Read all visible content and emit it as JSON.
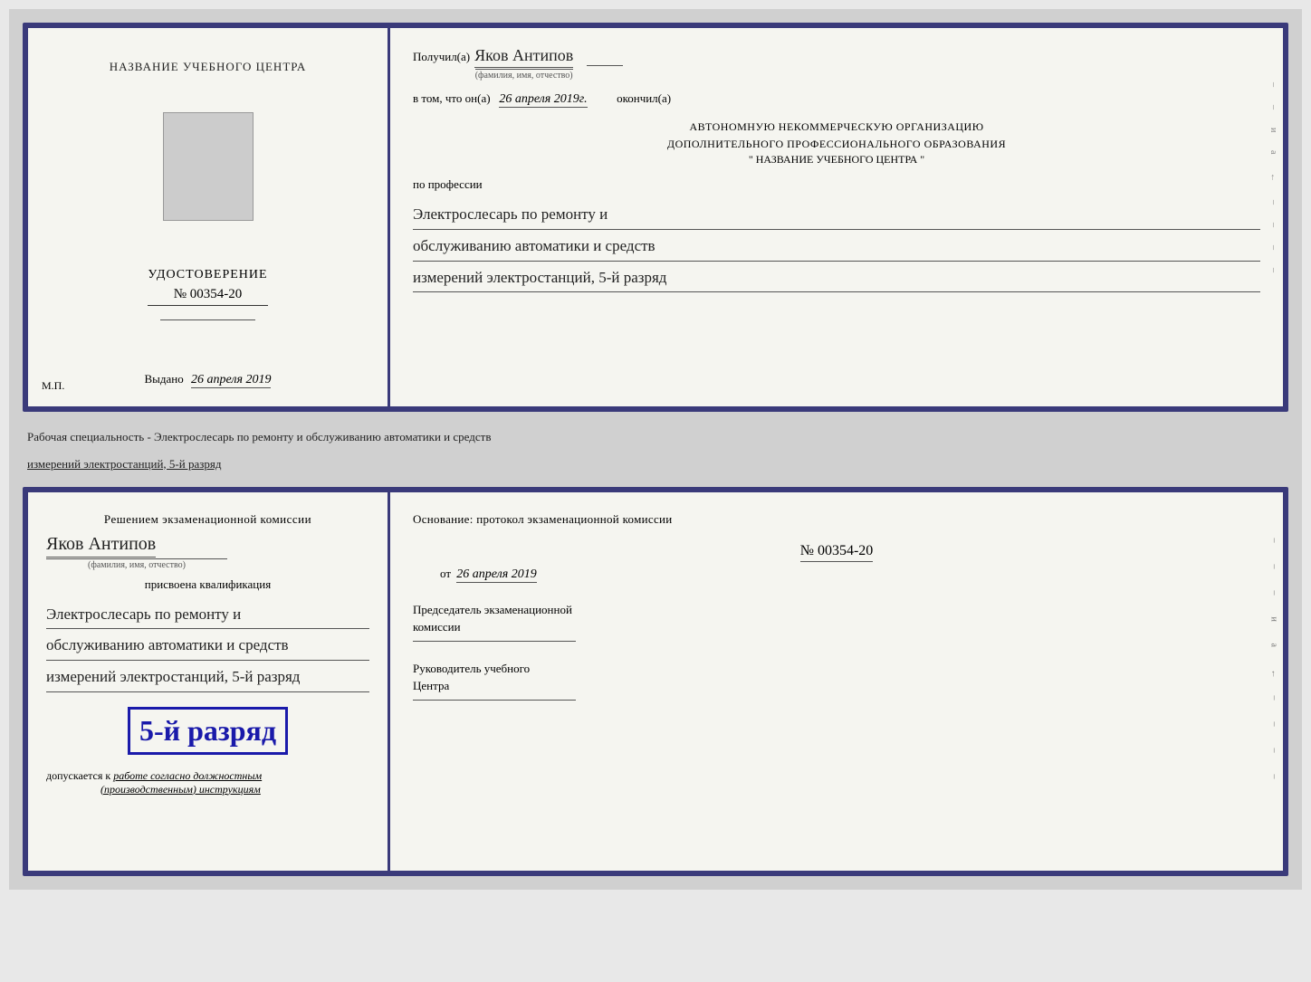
{
  "top_cert": {
    "left": {
      "title": "НАЗВАНИЕ УЧЕБНОГО ЦЕНТРА",
      "udostoverenie": "УДОСТОВЕРЕНИЕ",
      "number": "№ 00354-20",
      "issued_label": "Выдано",
      "issued_date": "26 апреля 2019",
      "mp": "М.П."
    },
    "right": {
      "poluchil_prefix": "Получил(а)",
      "name_handwritten": "Яков Антипов",
      "fio_label": "(фамилия, имя, отчество)",
      "vtom_prefix": "в том, что он(а)",
      "date_handwritten": "26 апреля 2019г.",
      "okonchil": "окончил(а)",
      "org_line1": "АВТОНОМНУЮ НЕКОММЕРЧЕСКУЮ ОРГАНИЗАЦИЮ",
      "org_line2": "ДОПОЛНИТЕЛЬНОГО ПРОФЕССИОНАЛЬНОГО ОБРАЗОВАНИЯ",
      "org_quote": "\"  НАЗВАНИЕ УЧЕБНОГО ЦЕНТРА  \"",
      "po_professii": "по профессии",
      "profession_line1": "Электрослесарь по ремонту и",
      "profession_line2": "обслуживанию автоматики и средств",
      "profession_line3": "измерений электростанций, 5-й разряд",
      "deco_chars": [
        "–",
        "–",
        "и",
        "а",
        "←",
        "–",
        "–",
        "–",
        "–"
      ]
    }
  },
  "middle": {
    "text": "Рабочая специальность - Электрослесарь по ремонту и обслуживанию автоматики и средств",
    "text2": "измерений электростанций, 5-й разряд"
  },
  "bottom_cert": {
    "left": {
      "resolution_line1": "Решением экзаменационной комиссии",
      "name_handwritten": "Яков Антипов",
      "fio_label": "(фамилия, имя, отчество)",
      "prisvoena": "присвоена квалификация",
      "qual_line1": "Электрослесарь по ремонту и",
      "qual_line2": "обслуживанию автоматики и средств",
      "qual_line3": "измерений электростанций, 5-й разряд",
      "big_rank": "5-й разряд",
      "dopuskaetsya": "допускается к",
      "work_desc": "работе согласно должностным",
      "work_desc2": "(производственным) инструкциям"
    },
    "right": {
      "osnovaniye": "Основание: протокол экзаменационной комиссии",
      "number": "№ 00354-20",
      "ot_prefix": "от",
      "ot_date": "26 апреля 2019",
      "chairman_line1": "Председатель экзаменационной",
      "chairman_line2": "комиссии",
      "ruk_line1": "Руководитель учебного",
      "ruk_line2": "Центра",
      "deco_chars": [
        "–",
        "–",
        "–",
        "и",
        "а",
        "←",
        "–",
        "–",
        "–",
        "–"
      ]
    }
  }
}
